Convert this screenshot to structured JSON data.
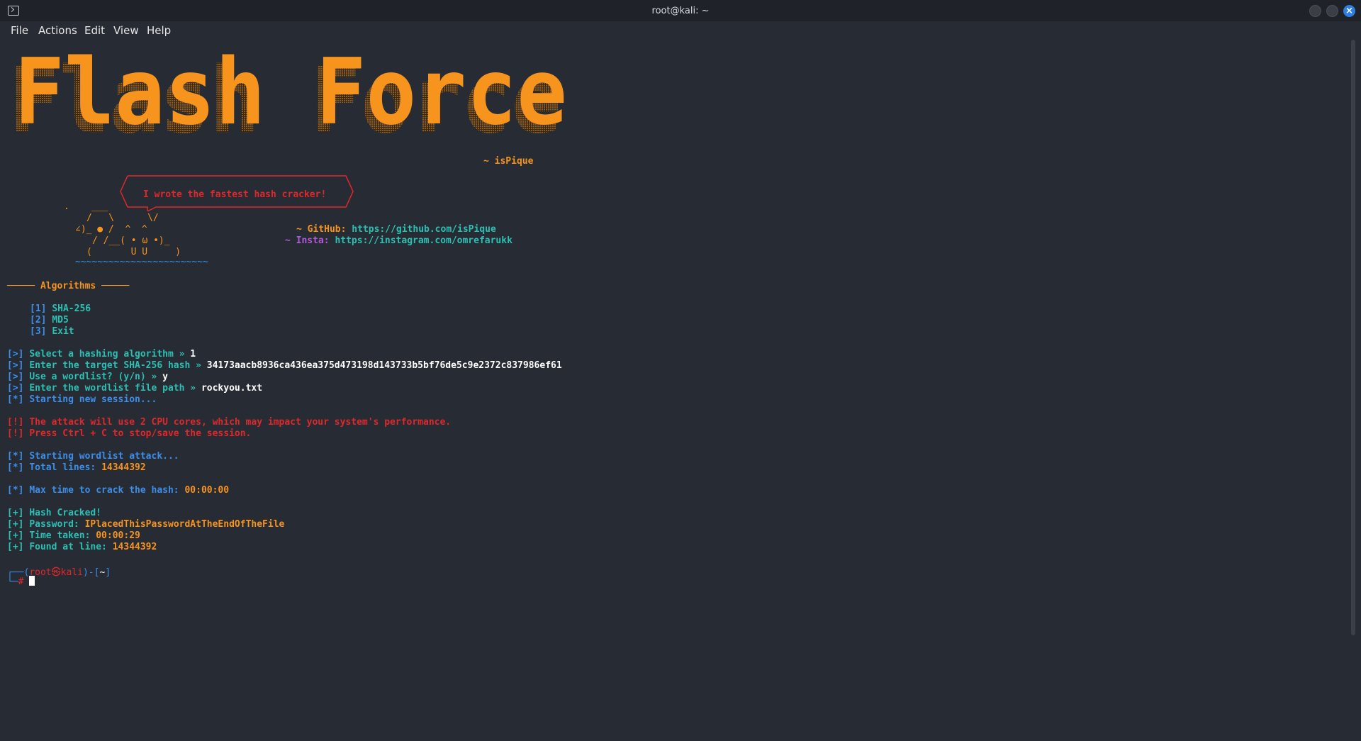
{
  "window": {
    "title": "root@kali: ~"
  },
  "menu": [
    "File",
    "Actions",
    "Edit",
    "View",
    "Help"
  ],
  "banner": {
    "title_text": "Flash Force",
    "author": "~ isPique",
    "color": "#f7941d"
  },
  "mascot": {
    "speech": "I wrote the fastest hash cracker!",
    "line1": ".    ___",
    "line2": "/   \\      \\/",
    "line3": "∠)_ ● /  ^  ^",
    "line4": "/ /__( • ω •)_",
    "line5": "(       U U     )",
    "line6": "~~~~~~~~~~~~~~~~~~~~~~~~"
  },
  "links": {
    "github_label": "~ GitHub:",
    "github_url": "https://github.com/isPique",
    "insta_label": "~ Insta:",
    "insta_url": "https://instagram.com/omrefarukk"
  },
  "algorithms": {
    "header_left": "─────",
    "header_title": "Algorithms",
    "header_right": "─────",
    "items": [
      {
        "key": "[1]",
        "label": "SHA-256"
      },
      {
        "key": "[2]",
        "label": "MD5"
      },
      {
        "key": "[3]",
        "label": "Exit"
      }
    ]
  },
  "session": {
    "prompt_select": "[>]",
    "select_text": "Select a hashing algorithm » ",
    "select_value": "1",
    "prompt_hash": "[>]",
    "hash_text": "Enter the target SHA-256 hash » ",
    "hash_value": "34173aacb8936ca436ea375d473198d143733b5bf76de5c9e2372c837986ef61",
    "prompt_wordlist": "[>]",
    "wordlist_text": "Use a wordlist? (y/n) » ",
    "wordlist_value": "y",
    "prompt_path": "[>]",
    "path_text": "Enter the wordlist file path » ",
    "path_value": "rockyou.txt",
    "starting_tag": "[*]",
    "starting_text": "Starting new session...",
    "warn1_tag": "[!]",
    "warn1_text": "The attack will use 2 CPU cores, which may impact your system's performance.",
    "warn2_tag": "[!]",
    "warn2_text": "Press Ctrl + C to stop/save the session.",
    "attack_tag": "[*]",
    "attack_text": "Starting wordlist attack...",
    "lines_tag": "[*]",
    "lines_text": "Total lines: ",
    "lines_value": "14344392",
    "max_tag": "[*]",
    "max_text": "Max time to crack the hash: ",
    "max_value": "00:00:00",
    "cracked_tag": "[+]",
    "cracked_text": "Hash Cracked!",
    "pwd_tag": "[+]",
    "pwd_text": "Password: ",
    "pwd_value": "IPlacedThisPasswordAtTheEndOfTheFile",
    "time_tag": "[+]",
    "time_text": "Time taken: ",
    "time_value": "00:00:29",
    "found_tag": "[+]",
    "found_text": "Found at line: ",
    "found_value": "14344392"
  },
  "prompt": {
    "corner_top": "┌──(",
    "user": "root",
    "at": "㉿",
    "host": "kali",
    "mid": ")-[",
    "dir": "~",
    "end": "]",
    "corner_bottom": "└─",
    "hash": "#"
  }
}
